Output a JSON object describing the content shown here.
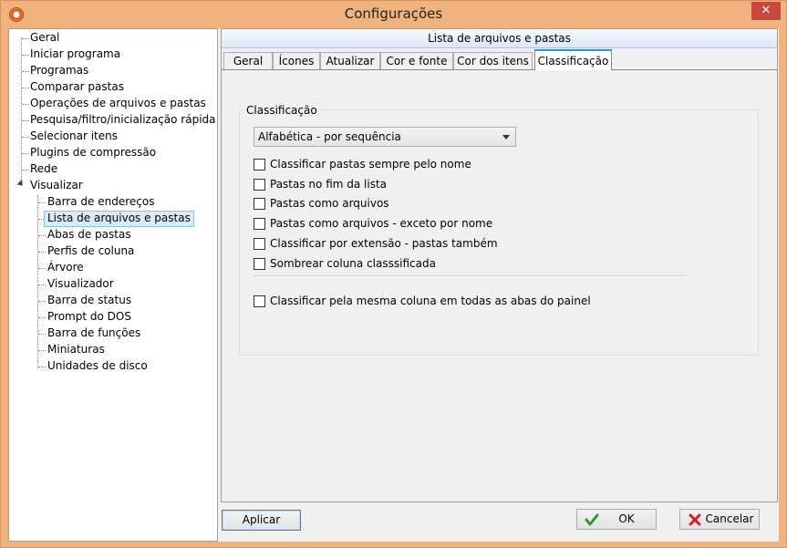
{
  "window": {
    "title": "Configurações",
    "close_glyph": "✕"
  },
  "tree": {
    "items": [
      {
        "label": "Geral"
      },
      {
        "label": "Iniciar programa"
      },
      {
        "label": "Programas"
      },
      {
        "label": "Comparar pastas"
      },
      {
        "label": "Operações de arquivos e pastas"
      },
      {
        "label": "Pesquisa/filtro/inicialização rápida"
      },
      {
        "label": "Selecionar itens"
      },
      {
        "label": "Plugins de compressão"
      },
      {
        "label": "Rede"
      },
      {
        "label": "Visualizar",
        "expanded": true
      }
    ],
    "children": [
      {
        "label": "Barra de endereços"
      },
      {
        "label": "Lista de arquivos e pastas",
        "selected": true
      },
      {
        "label": "Abas de pastas"
      },
      {
        "label": "Perfis de coluna"
      },
      {
        "label": "Árvore"
      },
      {
        "label": "Visualizador"
      },
      {
        "label": "Barra de status"
      },
      {
        "label": "Prompt do DOS"
      },
      {
        "label": "Barra de funções"
      },
      {
        "label": "Miniaturas"
      },
      {
        "label": "Unidades de disco"
      }
    ]
  },
  "panel": {
    "header": "Lista de arquivos e pastas",
    "tabs": [
      {
        "label": "Geral"
      },
      {
        "label": "Ícones"
      },
      {
        "label": "Atualizar"
      },
      {
        "label": "Cor e fonte"
      },
      {
        "label": "Cor dos itens"
      },
      {
        "label": "Classificação",
        "active": true
      }
    ],
    "group_label": "Classificação",
    "sort_select": {
      "value": "Alfabética - por sequência"
    },
    "checkboxes": [
      {
        "label": "Classificar pastas sempre pelo nome",
        "checked": false
      },
      {
        "label": "Pastas no fim da lista",
        "checked": false
      },
      {
        "label": "Pastas como arquivos",
        "checked": false
      },
      {
        "label": "Pastas como arquivos - exceto por nome",
        "checked": false
      },
      {
        "label": "Classificar por extensão - pastas também",
        "checked": false
      },
      {
        "label": "Sombrear coluna classsificada",
        "checked": false
      }
    ],
    "extra_checkbox": {
      "label": "Classificar pela mesma coluna em todas as abas do painel",
      "checked": false
    }
  },
  "buttons": {
    "apply": "Aplicar",
    "ok": "OK",
    "cancel": "Cancelar"
  },
  "colors": {
    "frame": "#f0b37f",
    "close": "#c7483d",
    "tab_accent": "#3c8fd5",
    "ok_icon": "#2e9a2e",
    "cancel_icon": "#d42020"
  }
}
